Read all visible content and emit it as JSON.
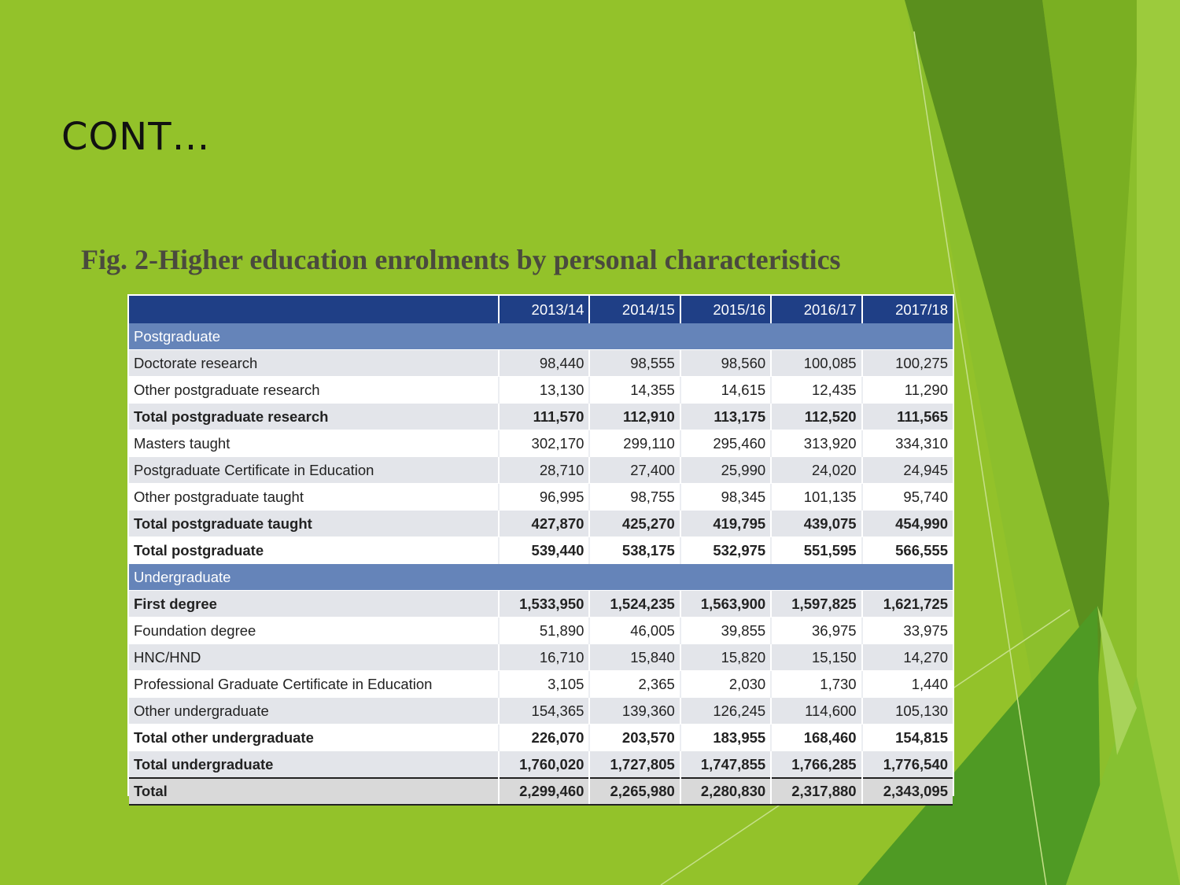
{
  "slide": {
    "title": "CONT…",
    "caption": "Fig. 2-Higher education enrolments by personal characteristics"
  },
  "colors": {
    "background": "#93c22a",
    "header": "#1f3f86",
    "section": "#6584b9",
    "row_shade": "#e3e5ea"
  },
  "table": {
    "corner": "",
    "columns": [
      "2013/14",
      "2014/15",
      "2015/16",
      "2016/17",
      "2017/18"
    ],
    "sections": [
      {
        "title": "Postgraduate",
        "rows": [
          {
            "label": "Doctorate research",
            "values": [
              "98,440",
              "98,555",
              "98,560",
              "100,085",
              "100,275"
            ],
            "bold": false
          },
          {
            "label": "Other postgraduate research",
            "values": [
              "13,130",
              "14,355",
              "14,615",
              "12,435",
              "11,290"
            ],
            "bold": false
          },
          {
            "label": "Total postgraduate research",
            "values": [
              "111,570",
              "112,910",
              "113,175",
              "112,520",
              "111,565"
            ],
            "bold": true
          },
          {
            "label": "Masters taught",
            "values": [
              "302,170",
              "299,110",
              "295,460",
              "313,920",
              "334,310"
            ],
            "bold": false
          },
          {
            "label": "Postgraduate Certificate in Education",
            "values": [
              "28,710",
              "27,400",
              "25,990",
              "24,020",
              "24,945"
            ],
            "bold": false
          },
          {
            "label": "Other postgraduate taught",
            "values": [
              "96,995",
              "98,755",
              "98,345",
              "101,135",
              "95,740"
            ],
            "bold": false
          },
          {
            "label": "Total postgraduate taught",
            "values": [
              "427,870",
              "425,270",
              "419,795",
              "439,075",
              "454,990"
            ],
            "bold": true
          },
          {
            "label": "Total postgraduate",
            "values": [
              "539,440",
              "538,175",
              "532,975",
              "551,595",
              "566,555"
            ],
            "bold": true
          }
        ]
      },
      {
        "title": "Undergraduate",
        "rows": [
          {
            "label": "First degree",
            "values": [
              "1,533,950",
              "1,524,235",
              "1,563,900",
              "1,597,825",
              "1,621,725"
            ],
            "bold": true
          },
          {
            "label": "Foundation degree",
            "values": [
              "51,890",
              "46,005",
              "39,855",
              "36,975",
              "33,975"
            ],
            "bold": false
          },
          {
            "label": "HNC/HND",
            "values": [
              "16,710",
              "15,840",
              "15,820",
              "15,150",
              "14,270"
            ],
            "bold": false
          },
          {
            "label": "Professional Graduate Certificate in Education",
            "values": [
              "3,105",
              "2,365",
              "2,030",
              "1,730",
              "1,440"
            ],
            "bold": false
          },
          {
            "label": "Other undergraduate",
            "values": [
              "154,365",
              "139,360",
              "126,245",
              "114,600",
              "105,130"
            ],
            "bold": false
          },
          {
            "label": "Total other undergraduate",
            "values": [
              "226,070",
              "203,570",
              "183,955",
              "168,460",
              "154,815"
            ],
            "bold": true
          },
          {
            "label": "Total undergraduate",
            "values": [
              "1,760,020",
              "1,727,805",
              "1,747,855",
              "1,766,285",
              "1,776,540"
            ],
            "bold": true
          }
        ]
      }
    ],
    "total": {
      "label": "Total",
      "values": [
        "2,299,460",
        "2,265,980",
        "2,280,830",
        "2,317,880",
        "2,343,095"
      ]
    }
  }
}
